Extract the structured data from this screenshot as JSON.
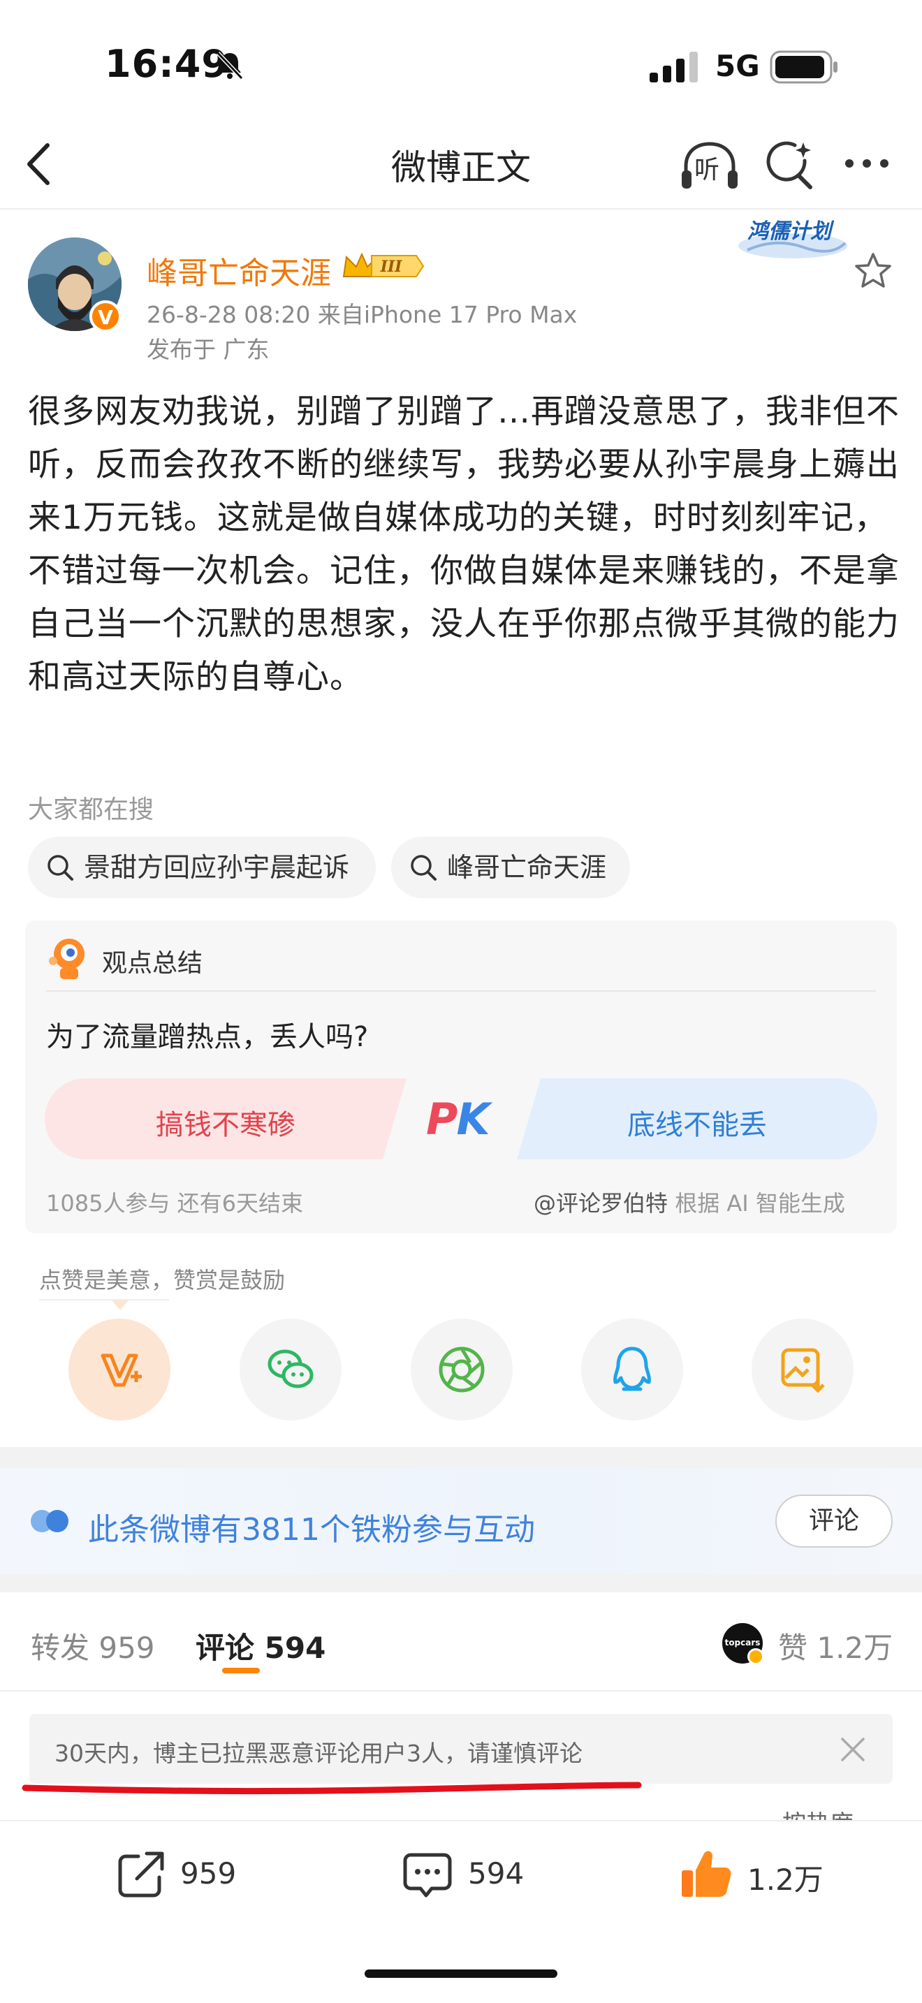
{
  "status_bar": {
    "time": "16:49",
    "network": "5G",
    "icons": [
      "silent-bell-icon",
      "signal-icon",
      "battery-icon"
    ]
  },
  "nav": {
    "title": "微博正文",
    "listen_label": "听",
    "icons": [
      "back-icon",
      "headphones-icon",
      "ai-search-icon",
      "more-icon"
    ]
  },
  "post": {
    "author": "峰哥亡命天涯",
    "member_badge": "III",
    "verified_mark": "V",
    "campaign_badge": "鸿儒计划",
    "meta": "26-8-28 08:20  来自iPhone 17 Pro Max",
    "location": "发布于 广东",
    "body": "很多网友劝我说，别蹭了别蹭了…再蹭没意思了，我非但不听，反而会孜孜不断的继续写，我势必要从孙宇晨身上薅出来1万元钱。这就是做自媒体成功的关键，时时刻刻牢记，不错过每一次机会。记住，你做自媒体是来赚钱的，不是拿自己当一个沉默的思想家，没人在乎你那点微乎其微的能力和高过天际的自尊心。"
  },
  "searches": {
    "label": "大家都在搜",
    "items": [
      "景甜方回应孙宇晨起诉",
      "峰哥亡命天涯"
    ]
  },
  "debate": {
    "label": "观点总结",
    "question": "为了流量蹭热点，丢人吗?",
    "left_option": "搞钱不寒碜",
    "right_option": "底线不能丢",
    "pk_p": "P",
    "pk_k": "K",
    "stats": "1085人参与  还有6天结束",
    "source_author": "@评论罗伯特",
    "source_suffix": " 根据 AI 智能生成"
  },
  "reward": {
    "hint": "点赞是美意，赞赏是鼓励",
    "share_targets": [
      "reward-icon",
      "wechat-icon",
      "moments-icon",
      "qq-icon",
      "save-image-icon"
    ]
  },
  "fans_banner": {
    "text": "此条微博有3811个铁粉参与互动",
    "button": "评论"
  },
  "tabs": {
    "repost": "转发 959",
    "comments": "评论 594",
    "likes": "赞 1.2万",
    "likes_avatar_text": "topcars"
  },
  "notice": {
    "text": "30天内，博主已拉黑恶意评论用户3人，请谨慎评论",
    "sort_peek": "按热度"
  },
  "bottom_bar": {
    "repost_count": "959",
    "comment_count": "594",
    "like_count": "1.2万"
  },
  "colors": {
    "accent_orange": "#ff8200",
    "author_name": "#f0780a",
    "link_blue": "#3f82dd",
    "pk_red": "#e0444c",
    "pk_blue": "#2f7fd6"
  }
}
